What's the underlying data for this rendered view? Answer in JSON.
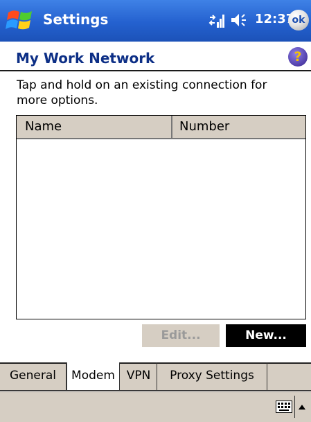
{
  "titlebar": {
    "app_title": "Settings",
    "clock": "12:37",
    "ok_label": "ok",
    "icons": [
      "windows-start-icon",
      "connectivity-icon",
      "volume-icon"
    ]
  },
  "header": {
    "title": "My Work Network",
    "help_glyph": "?"
  },
  "instructions": "Tap and hold on an existing connection for more options.",
  "list": {
    "columns": [
      "Name",
      "Number"
    ],
    "rows": []
  },
  "buttons": {
    "edit": "Edit...",
    "new": "New..."
  },
  "tabs": [
    {
      "label": "General",
      "active": false
    },
    {
      "label": "Modem",
      "active": true
    },
    {
      "label": "VPN",
      "active": false
    },
    {
      "label": "Proxy Settings",
      "active": false
    }
  ],
  "colors": {
    "titlebar": "#2461cf",
    "header_text": "#0d2f86",
    "panel": "#d6cec3"
  },
  "command_bar": {
    "icons": [
      "keyboard-icon",
      "input-selector-arrow-icon"
    ]
  }
}
